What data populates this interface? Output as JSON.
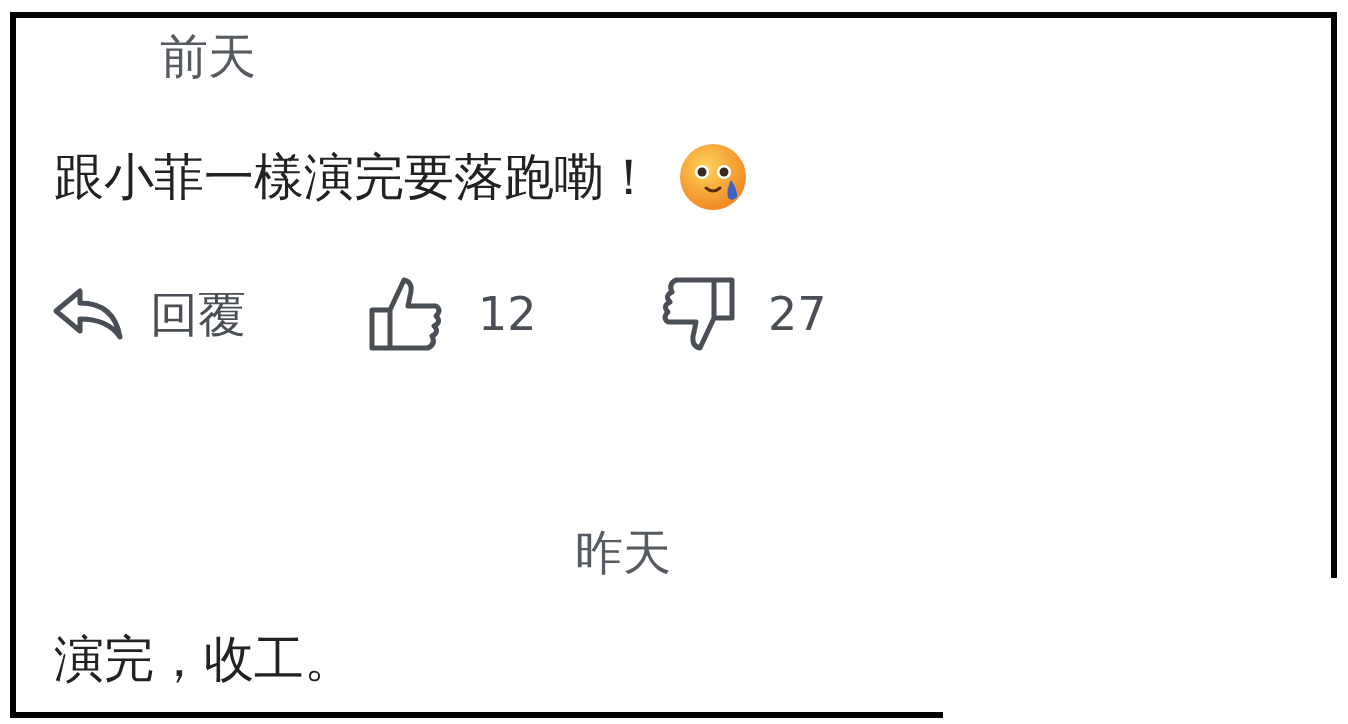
{
  "comments": [
    {
      "date": "前天",
      "text": "跟小菲一樣演完要落跑嘞！",
      "has_emoji": true,
      "actions": {
        "reply": "回覆",
        "likes": "12",
        "dislikes": "27"
      }
    },
    {
      "date": "昨天",
      "text": "演完，收工。",
      "has_emoji": false
    }
  ]
}
